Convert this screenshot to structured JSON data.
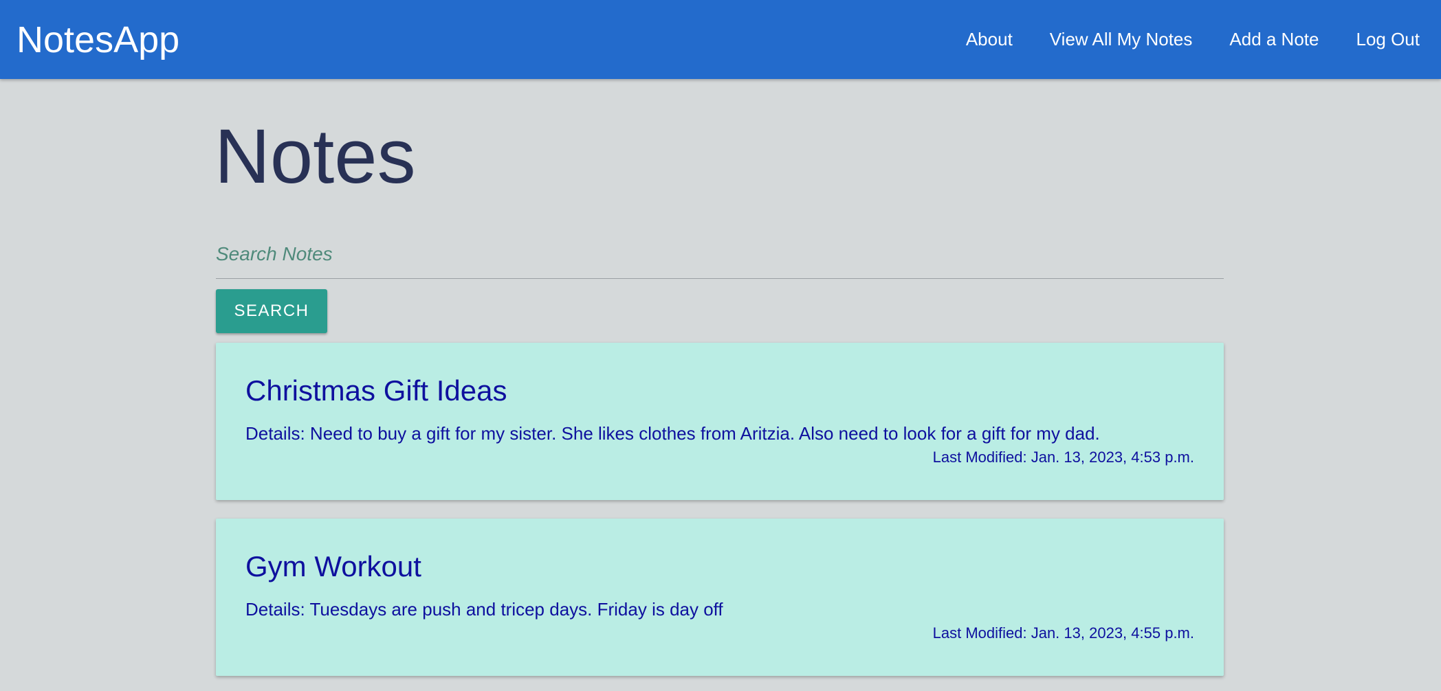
{
  "navbar": {
    "brand": "NotesApp",
    "links": [
      {
        "label": "About"
      },
      {
        "label": "View All My Notes"
      },
      {
        "label": "Add a Note"
      },
      {
        "label": "Log Out"
      }
    ]
  },
  "main": {
    "title": "Notes",
    "search": {
      "placeholder": "Search Notes",
      "value": "",
      "button_label": "SEARCH"
    },
    "notes": [
      {
        "title": "Christmas Gift Ideas",
        "details": "Details: Need to buy a gift for my sister. She likes clothes from Aritzia. Also need to look for a gift for my dad.",
        "last_modified": "Last Modified: Jan. 13, 2023, 4:53 p.m."
      },
      {
        "title": "Gym Workout",
        "details": "Details: Tuesdays are push and tricep days. Friday is day off",
        "last_modified": "Last Modified: Jan. 13, 2023, 4:55 p.m."
      }
    ]
  },
  "colors": {
    "navbar": "#236bcc",
    "background": "#d5d9da",
    "button": "#2a9d8f",
    "card": "#baede4",
    "card_text": "#0e109e",
    "title": "#283155"
  }
}
